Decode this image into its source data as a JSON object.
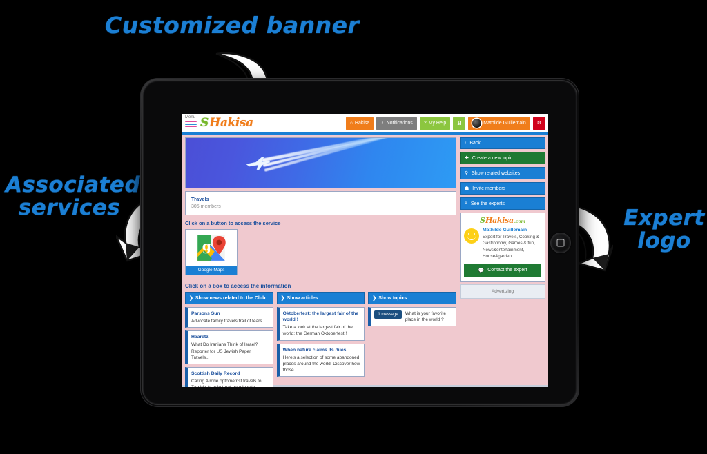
{
  "annotations": {
    "banner": "Customized banner",
    "services": "Associated\nservices",
    "expert": "Expert\nlogo"
  },
  "topbar": {
    "menu_label": "Menu",
    "logo_s": "S",
    "logo_text": "Hakisa",
    "nav": [
      {
        "label": "Hakisa",
        "icon": "home-icon",
        "glyph": "⌂",
        "color": "#f07d1b",
        "style": "orange"
      },
      {
        "label": "Notifications",
        "icon": "bell-icon",
        "glyph": "♀",
        "color": "#7e7e7e",
        "style": "gray"
      },
      {
        "label": "My Help",
        "icon": "question-icon",
        "glyph": "?",
        "color": "#8cc63f",
        "style": "green"
      },
      {
        "label": "B",
        "icon": "bold-icon",
        "glyph": "",
        "color": "#8cc63f",
        "style": "green sq"
      },
      {
        "label": "Mathilde Guillemain",
        "icon": "avatar-icon",
        "glyph": "",
        "color": "#f07d1b",
        "style": "orange"
      },
      {
        "label": "",
        "icon": "gear-icon",
        "glyph": "⚙",
        "color": "#d0021b",
        "style": "red"
      }
    ]
  },
  "main": {
    "banner_alt": "airplane-contrail-banner",
    "club": {
      "title": "Travels",
      "members": "305 members"
    },
    "service_hint": "Click on a button to access the service",
    "services": [
      {
        "label": "Google Maps",
        "icon": "google-maps-icon"
      }
    ],
    "box_hint": "Click on a box to access the information",
    "columns": [
      {
        "header": "Show news related to the Club",
        "icon": "chevron-right-icon",
        "cards": [
          {
            "title": "Parsons Sun",
            "body": "Advocate family travels trail of tears"
          },
          {
            "title": "Haaretz",
            "body": "What Do Iranians Think of Israel? Reporter for US Jewish Paper Travels..."
          },
          {
            "title": "Scottish Daily Record",
            "body": "Caring Airdrie optometrist travels to Zambia to help treat people with..."
          }
        ]
      },
      {
        "header": "Show articles",
        "icon": "chevron-right-icon",
        "cards": [
          {
            "title": "Oktoberfest: the largest fair of the world !",
            "body": "Take a look at the largest fair of the world: the German Oktoberfest !"
          },
          {
            "title": "When nature claims its dues",
            "body": "Here's a selection of some abandoned places around the world. Discover how those..."
          }
        ]
      },
      {
        "header": "Show topics",
        "icon": "chevron-right-icon",
        "topics": [
          {
            "badge": "1 message",
            "text": "What is your favorite place in the world ?"
          }
        ]
      }
    ]
  },
  "sidebar": {
    "buttons": [
      {
        "label": "Back",
        "icon": "chevron-left-icon",
        "glyph": "‹",
        "style": "blue"
      },
      {
        "label": "Create a new topic",
        "icon": "plus-icon",
        "glyph": "✚",
        "style": "green"
      },
      {
        "label": "Show related websites",
        "icon": "globe-icon",
        "glyph": "⚲",
        "style": "blue"
      },
      {
        "label": "Invite members",
        "icon": "user-add-icon",
        "glyph": "☗",
        "style": "blue"
      },
      {
        "label": "See the experts",
        "icon": "search-icon",
        "glyph": "⌕",
        "style": "blue"
      }
    ],
    "expert": {
      "logo_s": "S",
      "logo_text": "Hakisa",
      "logo_domain": ".com",
      "name": "Mathilde Guillemain",
      "description": "Expert for Travels, Cooking & Gastronomy, Games & fun, News&entertainment, House&garden",
      "contact_label": "Contact the expert",
      "contact_icon": "chat-icon"
    },
    "advertising_label": "Advertizing"
  },
  "colors": {
    "accent_blue": "#1a7fd4",
    "brand_orange": "#f07d1b",
    "brand_green": "#76b82a",
    "annotation_blue": "#1b7fd4",
    "page_frame_pink": "#f0c9cf"
  }
}
